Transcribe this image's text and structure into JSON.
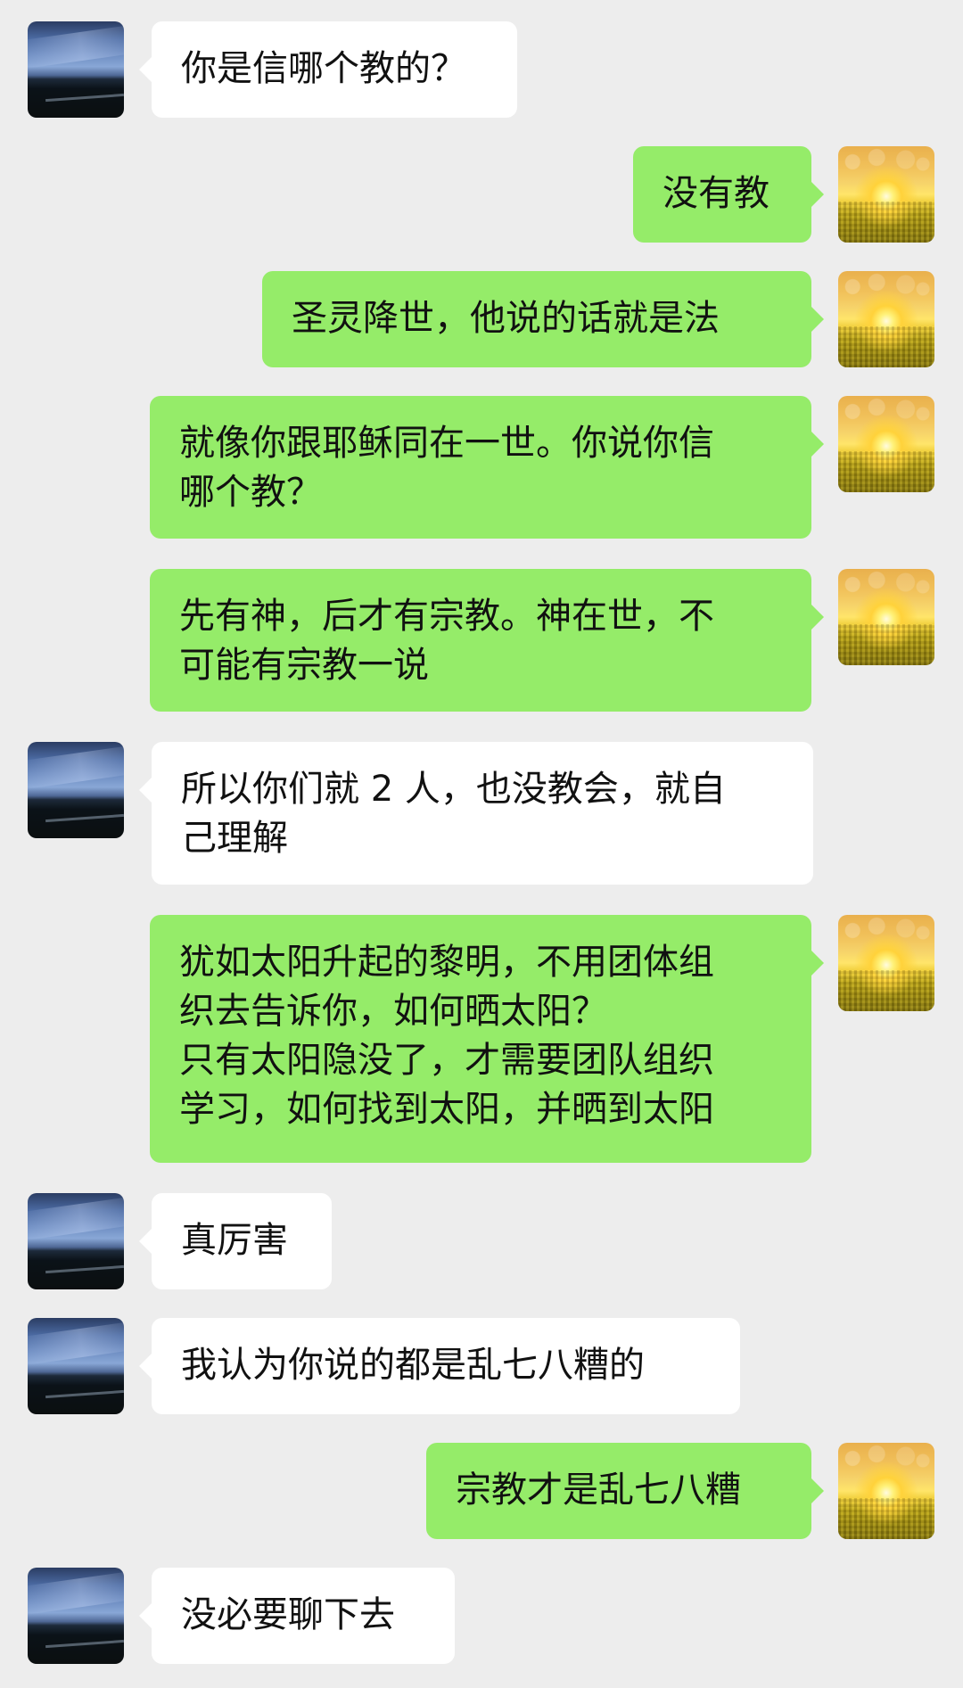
{
  "messages": [
    {
      "side": "left",
      "avatar": "sky",
      "text": "你是信哪个教的？"
    },
    {
      "side": "right",
      "avatar": "sun",
      "text": "没有教"
    },
    {
      "side": "right",
      "avatar": "sun",
      "text": "圣灵降世，他说的话就是法"
    },
    {
      "side": "right",
      "avatar": "sun",
      "text": "就像你跟耶稣同在一世。你说你信\n哪个教？"
    },
    {
      "side": "right",
      "avatar": "sun",
      "text": "先有神，后才有宗教。神在世，不\n可能有宗教一说"
    },
    {
      "side": "left",
      "avatar": "sky",
      "text": "所以你们就 2 人，也没教会，就自\n己理解"
    },
    {
      "side": "right",
      "avatar": "sun",
      "text": "犹如太阳升起的黎明，不用团体组\n织去告诉你，如何晒太阳？\n只有太阳隐没了，才需要团队组织\n学习，如何找到太阳，并晒到太阳"
    },
    {
      "side": "left",
      "avatar": "sky",
      "text": "真厉害"
    },
    {
      "side": "left",
      "avatar": "sky",
      "text": "我认为你说的都是乱七八糟的"
    },
    {
      "side": "right",
      "avatar": "sun",
      "text": "宗教才是乱七八糟"
    },
    {
      "side": "left",
      "avatar": "sky",
      "text": "没必要聊下去"
    }
  ]
}
